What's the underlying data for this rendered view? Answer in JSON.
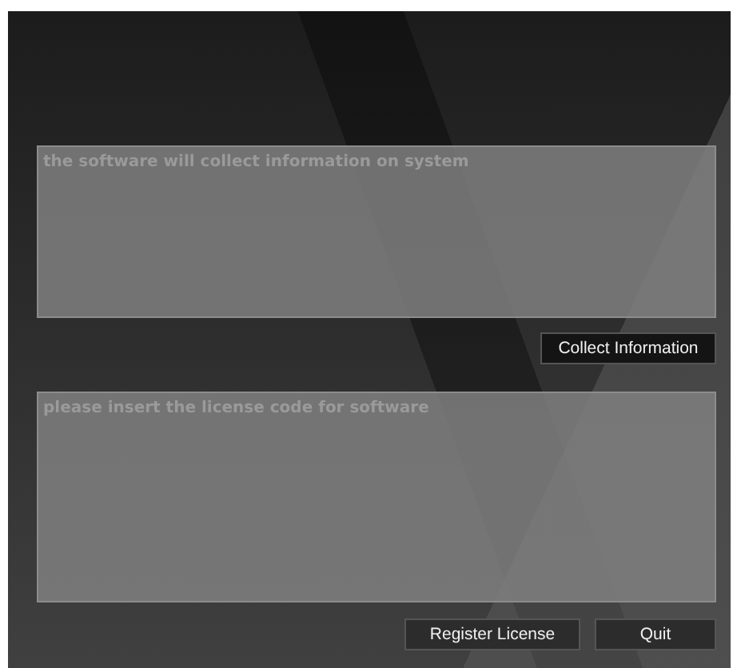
{
  "info_box": {
    "placeholder": "the software will collect information on system"
  },
  "collect_button": {
    "label": "Collect Information"
  },
  "license_box": {
    "placeholder": "please insert the license code for software"
  },
  "buttons": [
    {
      "kind": "register",
      "label": "Register License"
    },
    {
      "kind": "quit",
      "label": "Quit"
    }
  ]
}
